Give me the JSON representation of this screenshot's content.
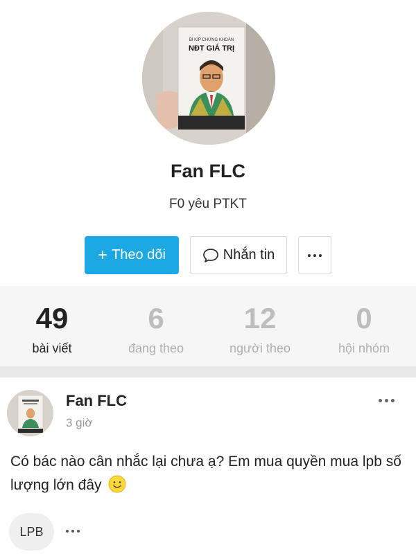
{
  "profile": {
    "name": "Fan FLC",
    "bio": "F0 yêu PTKT",
    "avatar_book": {
      "line1": "BÍ KÍP CHỨNG KHOÁN",
      "line2": "NĐT GIÁ TRỊ"
    }
  },
  "actions": {
    "follow_label": "Theo dõi",
    "follow_icon": "+",
    "message_label": "Nhắn tin",
    "message_icon": "chat-bubble-icon",
    "more_icon": "more-horizontal-icon"
  },
  "stats": [
    {
      "value": "49",
      "label": "bài viết"
    },
    {
      "value": "6",
      "label": "đang theo"
    },
    {
      "value": "12",
      "label": "người theo"
    },
    {
      "value": "0",
      "label": "hội nhóm"
    }
  ],
  "post": {
    "author": "Fan FLC",
    "time": "3 giờ",
    "text": "Có bác nào cân nhắc lại chưa ạ? Em mua quyền mua lpb số lượng lớn đây",
    "emoji": "slightly-smiling-face",
    "tag": "LPB"
  },
  "colors": {
    "accent": "#1ca8e3",
    "stats_bg": "#f6f6f6",
    "divider": "#e8e8e8"
  }
}
